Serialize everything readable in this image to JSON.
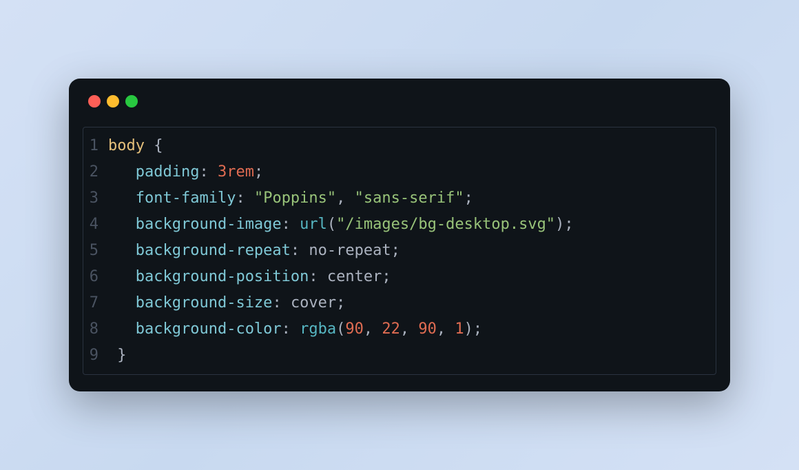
{
  "window": {
    "dots": [
      "red",
      "yellow",
      "green"
    ]
  },
  "code": {
    "lines": [
      {
        "number": "1",
        "tokens": [
          {
            "text": "body",
            "class": "tok-selector"
          },
          {
            "text": " ",
            "class": ""
          },
          {
            "text": "{",
            "class": "tok-brace"
          }
        ]
      },
      {
        "number": "2",
        "tokens": [
          {
            "text": "   ",
            "class": ""
          },
          {
            "text": "padding",
            "class": "tok-property"
          },
          {
            "text": ": ",
            "class": "tok-punct"
          },
          {
            "text": "3rem",
            "class": "tok-number"
          },
          {
            "text": ";",
            "class": "tok-punct"
          }
        ]
      },
      {
        "number": "3",
        "tokens": [
          {
            "text": "   ",
            "class": ""
          },
          {
            "text": "font-family",
            "class": "tok-property"
          },
          {
            "text": ": ",
            "class": "tok-punct"
          },
          {
            "text": "\"Poppins\"",
            "class": "tok-string"
          },
          {
            "text": ", ",
            "class": "tok-punct"
          },
          {
            "text": "\"sans-serif\"",
            "class": "tok-string"
          },
          {
            "text": ";",
            "class": "tok-punct"
          }
        ]
      },
      {
        "number": "4",
        "tokens": [
          {
            "text": "   ",
            "class": ""
          },
          {
            "text": "background-image",
            "class": "tok-property"
          },
          {
            "text": ": ",
            "class": "tok-punct"
          },
          {
            "text": "url",
            "class": "tok-func"
          },
          {
            "text": "(",
            "class": "tok-punct"
          },
          {
            "text": "\"/images/bg-desktop.svg\"",
            "class": "tok-string"
          },
          {
            "text": ")",
            "class": "tok-punct"
          },
          {
            "text": ";",
            "class": "tok-punct"
          }
        ]
      },
      {
        "number": "5",
        "tokens": [
          {
            "text": "   ",
            "class": ""
          },
          {
            "text": "background-repeat",
            "class": "tok-property"
          },
          {
            "text": ": ",
            "class": "tok-punct"
          },
          {
            "text": "no-repeat",
            "class": "tok-value"
          },
          {
            "text": ";",
            "class": "tok-punct"
          }
        ]
      },
      {
        "number": "6",
        "tokens": [
          {
            "text": "   ",
            "class": ""
          },
          {
            "text": "background-position",
            "class": "tok-property"
          },
          {
            "text": ": ",
            "class": "tok-punct"
          },
          {
            "text": "center",
            "class": "tok-value"
          },
          {
            "text": ";",
            "class": "tok-punct"
          }
        ]
      },
      {
        "number": "7",
        "tokens": [
          {
            "text": "   ",
            "class": ""
          },
          {
            "text": "background-size",
            "class": "tok-property"
          },
          {
            "text": ": ",
            "class": "tok-punct"
          },
          {
            "text": "cover",
            "class": "tok-value"
          },
          {
            "text": ";",
            "class": "tok-punct"
          }
        ]
      },
      {
        "number": "8",
        "tokens": [
          {
            "text": "   ",
            "class": ""
          },
          {
            "text": "background-color",
            "class": "tok-property"
          },
          {
            "text": ": ",
            "class": "tok-punct"
          },
          {
            "text": "rgba",
            "class": "tok-func"
          },
          {
            "text": "(",
            "class": "tok-punct"
          },
          {
            "text": "90",
            "class": "tok-number"
          },
          {
            "text": ", ",
            "class": "tok-punct"
          },
          {
            "text": "22",
            "class": "tok-number"
          },
          {
            "text": ", ",
            "class": "tok-punct"
          },
          {
            "text": "90",
            "class": "tok-number"
          },
          {
            "text": ", ",
            "class": "tok-punct"
          },
          {
            "text": "1",
            "class": "tok-number"
          },
          {
            "text": ")",
            "class": "tok-punct"
          },
          {
            "text": ";",
            "class": "tok-punct"
          }
        ]
      },
      {
        "number": "9",
        "tokens": [
          {
            "text": " ",
            "class": ""
          },
          {
            "text": "}",
            "class": "tok-brace"
          }
        ]
      }
    ]
  }
}
